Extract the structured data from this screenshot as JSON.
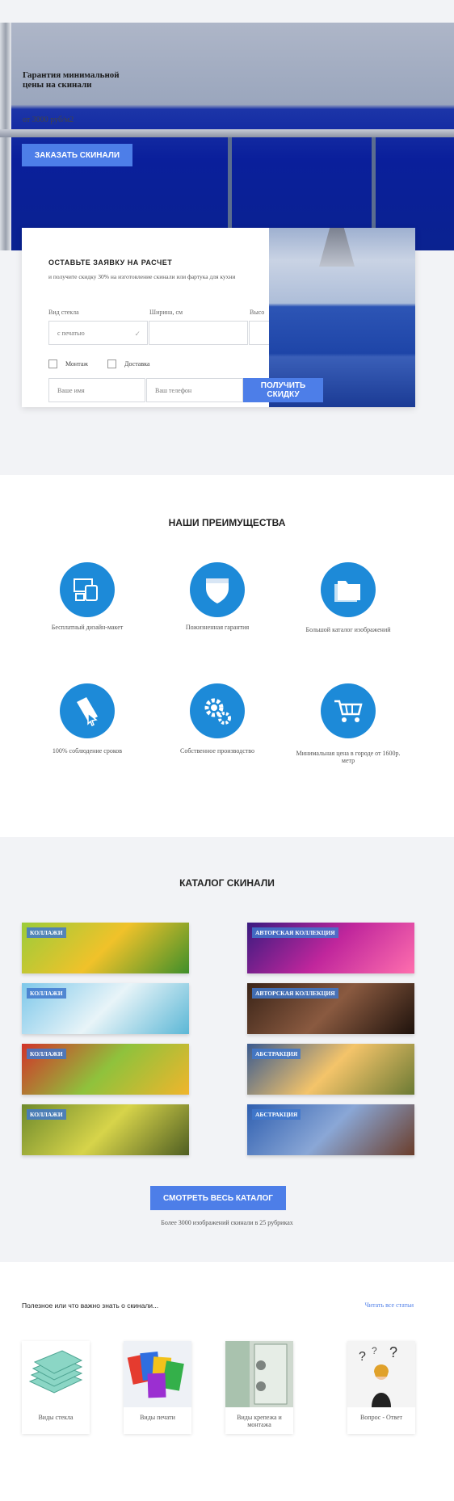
{
  "hero": {
    "title": "Гарантия минимальной цены на скинали",
    "price": "от 3000 руб/м2",
    "button": "ЗАКАЗАТЬ СКИНАЛИ"
  },
  "form": {
    "title": "ОСТАВЬТЕ ЗАЯВКУ НА РАСЧЕТ",
    "subtitle": "и получите скидку 30% на изготовление скинали или фартука для кухни",
    "label_glass": "Вид стекла",
    "label_width": "Ширина, см",
    "label_height": "Высо",
    "glass_value": "с печатью",
    "checkbox_mount": "Монтаж",
    "checkbox_delivery": "Доставка",
    "name_placeholder": "Ваше имя",
    "phone_placeholder": "Ваш телефон",
    "submit": "ПОЛУЧИТЬ СКИДКУ"
  },
  "advantages": {
    "title": "НАШИ ПРЕИМУЩЕСТВА",
    "items": [
      {
        "icon": "devices-icon",
        "label": "Бесплатный дизайн-макет"
      },
      {
        "icon": "shield-icon",
        "label": "Пожизненная гарантия"
      },
      {
        "icon": "folders-icon",
        "label": "Большой каталог изображений"
      },
      {
        "icon": "document-cursor-icon",
        "label": "100% соблюдение сроков"
      },
      {
        "icon": "gears-icon",
        "label": "Собственное производство"
      },
      {
        "icon": "cart-icon",
        "label": "Минимальная цена в городе от 1600р. метр"
      }
    ]
  },
  "catalog": {
    "title": "КАТАЛОГ СКИНАЛИ",
    "tiles": [
      {
        "tag": "КОЛЛАЖИ",
        "colors": [
          "#9ccc3a",
          "#f0c22a",
          "#3f8f2a"
        ]
      },
      {
        "tag": "АВТОРСКАЯ КОЛЛЕКЦИЯ",
        "colors": [
          "#3a1b80",
          "#c0269c",
          "#ff6fae"
        ]
      },
      {
        "tag": "КОЛЛАЖИ",
        "colors": [
          "#7ec8ea",
          "#e8f4f8",
          "#5bb7d6"
        ]
      },
      {
        "tag": "АВТОРСКАЯ КОЛЛЕКЦИЯ",
        "colors": [
          "#3a2418",
          "#8a5a40",
          "#1e120c"
        ]
      },
      {
        "tag": "КОЛЛАЖИ",
        "colors": [
          "#d2332a",
          "#8fc23c",
          "#f0b52c"
        ]
      },
      {
        "tag": "АБСТРАКЦИЯ",
        "colors": [
          "#3a5a8f",
          "#f4c46a",
          "#6b7a34"
        ]
      },
      {
        "tag": "КОЛЛАЖИ",
        "colors": [
          "#6e8a2c",
          "#d7d44a",
          "#4f5e22"
        ]
      },
      {
        "tag": "АБСТРАКЦИЯ",
        "colors": [
          "#2f5fb0",
          "#8aa7d6",
          "#6b3d2a"
        ]
      }
    ],
    "button": "СМОТРЕТЬ ВЕСЬ КАТАЛОГ",
    "note": "Более 3000 изображений скинали в 25 рубриках"
  },
  "articles": {
    "heading": "Полезное или что важно знать о скинали...",
    "link": "Читать все статьи",
    "items": [
      {
        "caption": "Виды стекла"
      },
      {
        "caption": "Виды печати"
      },
      {
        "caption": "Виды крепежа и монтажа"
      },
      {
        "caption": "Вопрос - Ответ"
      }
    ]
  },
  "colors": {
    "accent": "#4d7ee8",
    "icon_blue": "#1d8ad8"
  }
}
